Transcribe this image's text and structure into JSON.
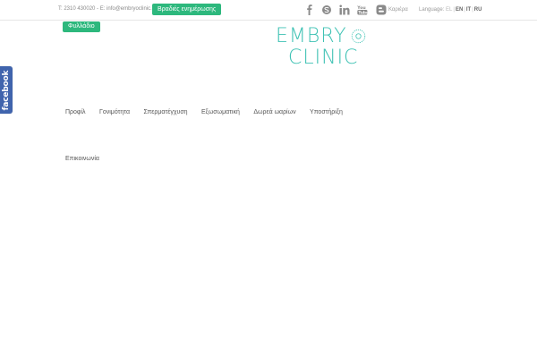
{
  "topbar": {
    "contact": "T: 2310 430020 - E: info@embryoclinic.eu",
    "newsletter_label": "Βραδιές ενημέρωσης",
    "social_icons": [
      "facebook-icon",
      "skype-icon",
      "linkedin-icon",
      "youtube-icon",
      "blogger-icon"
    ],
    "careers_label": "Καριέρα",
    "language_label": "Language:",
    "languages": [
      "EL",
      "EN",
      "IT",
      "RU"
    ],
    "active_language": "EL"
  },
  "brochure_label": "Φυλλάδιο",
  "logo": {
    "line1": "EMBRY",
    "line2": "CLINIC",
    "color": "#3fc2b4"
  },
  "nav": {
    "items": [
      "Προφίλ",
      "Γονιμότητα",
      "Σπερματέγχυση",
      "Εξωσωματική",
      "Δωρεά ωαρίων",
      "Υποστήριξη"
    ]
  },
  "contact_link": "Επικοινωνία",
  "facebook_tab": "facebook",
  "colors": {
    "accent_green": "#2db87d",
    "logo_teal": "#3fc2b4",
    "facebook_blue": "#4064ad"
  }
}
